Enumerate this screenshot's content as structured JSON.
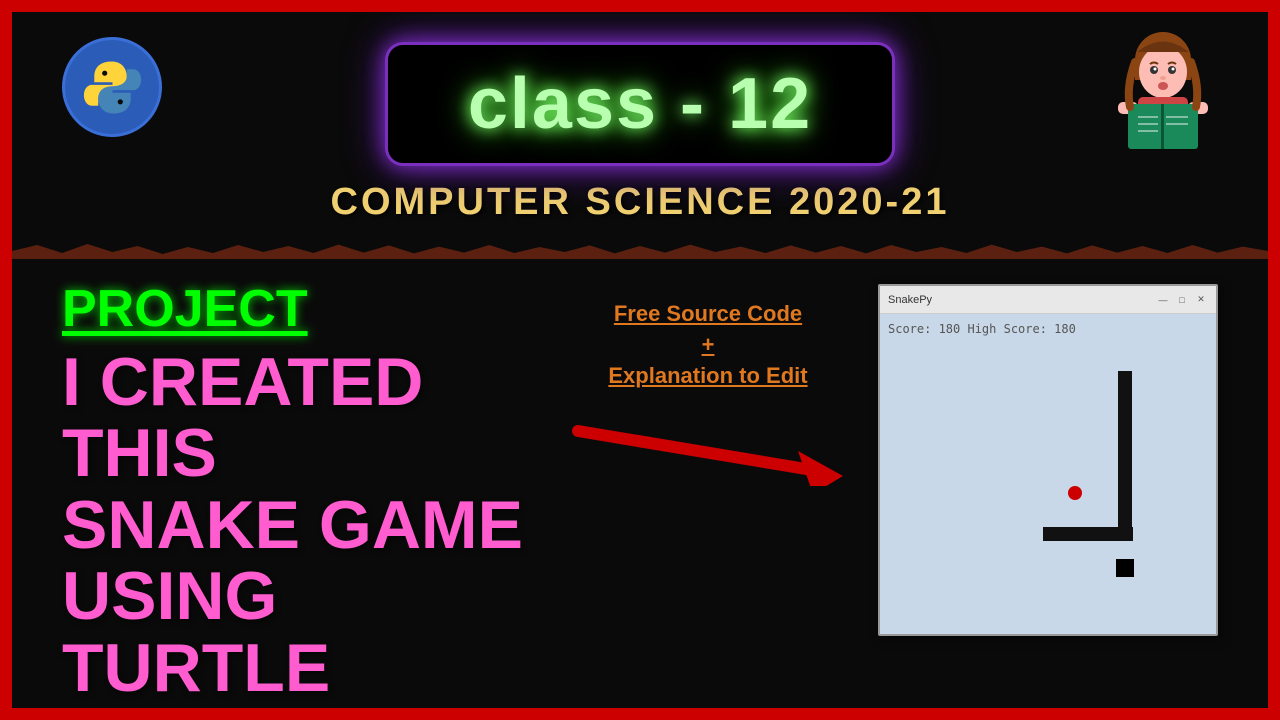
{
  "border": {
    "color": "#cc0000"
  },
  "class_badge": {
    "text": "class - 12"
  },
  "cs_subtitle": {
    "text": "COMPUTER SCIENCE 2020-21"
  },
  "project_label": {
    "text": "PROJECT"
  },
  "main_title_line1": "I CREATED THIS",
  "main_title_line2": "SNAKE GAME",
  "main_title_line3": "USING TURTLE",
  "free_source": {
    "line1": "Free Source Code",
    "plus": "+",
    "line2": "Explanation to Edit"
  },
  "game_window": {
    "title": "SnakePy",
    "score_text": "Score: 180   High Score: 180",
    "controls": [
      "—",
      "□",
      "✕"
    ]
  }
}
